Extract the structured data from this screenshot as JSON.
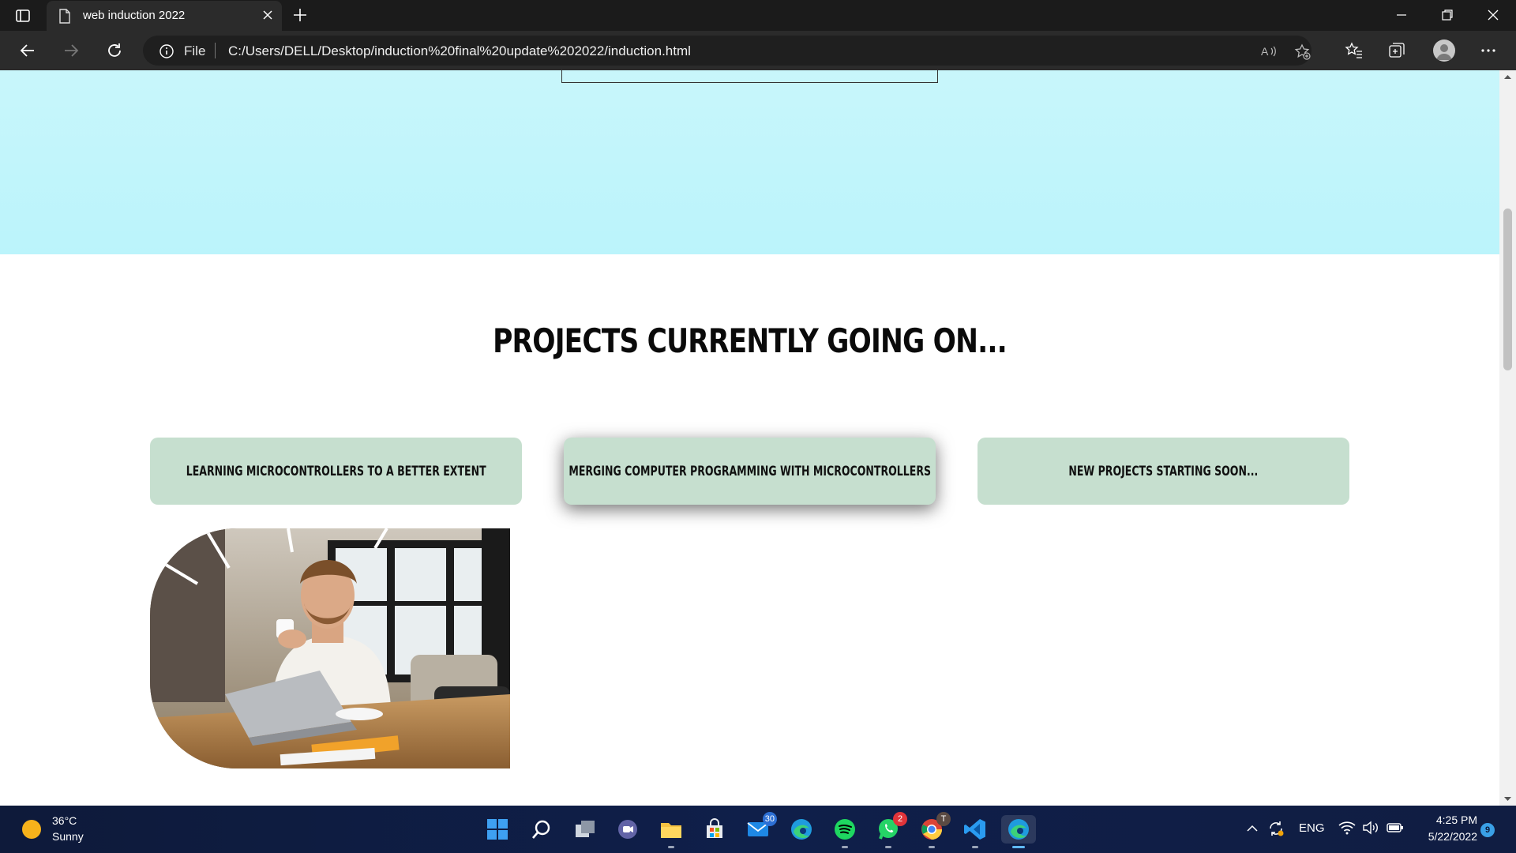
{
  "browser": {
    "tab_title": "web induction 2022",
    "address_prefix": "File",
    "url": "C:/Users/DELL/Desktop/induction%20final%20update%202022/induction.html"
  },
  "page": {
    "section_title": "PROJECTS CURRENTLY GOING ON...",
    "cards": [
      {
        "label": "LEARNING MICROCONTROLLERS TO A BETTER EXTENT"
      },
      {
        "label": "MERGING COMPUTER PROGRAMMING WITH MICROCONTROLLERS"
      },
      {
        "label": "NEW PROJECTS STARTING SOON..."
      }
    ],
    "hero_color": "#bff5fb",
    "card_color": "#c6dfcf"
  },
  "taskbar": {
    "weather_temp": "36°C",
    "weather_condition": "Sunny",
    "mail_badge": "30",
    "whatsapp_badge": "2",
    "chrome_badge": "T",
    "language": "ENG",
    "time": "4:25 PM",
    "date": "5/22/2022",
    "notification_count": "9"
  }
}
